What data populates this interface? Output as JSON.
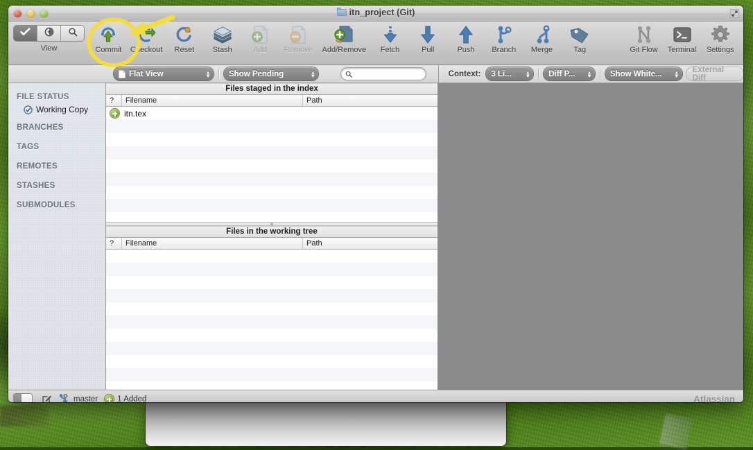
{
  "window": {
    "title": "itn_project (Git)",
    "title_icon": "folder-icon",
    "zoom_icon": "fullscreen-icon"
  },
  "toolbar": {
    "view_group_label": "View",
    "view_segments": [
      {
        "name": "checkmark-icon",
        "selected": true
      },
      {
        "name": "clock-history-icon",
        "selected": false
      },
      {
        "name": "search-icon",
        "selected": false
      }
    ],
    "items": [
      {
        "label": "Commit",
        "icon": "commit-up-arrow-icon",
        "enabled": true,
        "highlighted": true
      },
      {
        "label": "Checkout",
        "icon": "checkout-arrow-icon",
        "enabled": true,
        "highlighted": false
      },
      {
        "label": "Reset",
        "icon": "reset-circular-arrow-icon",
        "enabled": true,
        "highlighted": false
      },
      {
        "label": "Stash",
        "icon": "stash-box-icon",
        "enabled": true,
        "highlighted": false
      },
      {
        "label": "Add",
        "icon": "add-plus-file-icon",
        "enabled": false,
        "highlighted": false
      },
      {
        "label": "Remove",
        "icon": "remove-minus-file-icon",
        "enabled": false,
        "highlighted": false
      },
      {
        "label": "Add/Remove",
        "icon": "add-remove-file-icon",
        "enabled": true,
        "highlighted": false
      },
      {
        "label": "Fetch",
        "icon": "fetch-down-arrow-icon",
        "enabled": true,
        "highlighted": false
      },
      {
        "label": "Pull",
        "icon": "pull-down-arrow-icon",
        "enabled": true,
        "highlighted": false
      },
      {
        "label": "Push",
        "icon": "push-up-arrow-icon",
        "enabled": true,
        "highlighted": false
      },
      {
        "label": "Branch",
        "icon": "branch-graph-icon",
        "enabled": true,
        "highlighted": false
      },
      {
        "label": "Merge",
        "icon": "merge-graph-icon",
        "enabled": true,
        "highlighted": false
      },
      {
        "label": "Tag",
        "icon": "tag-label-icon",
        "enabled": true,
        "highlighted": false
      },
      {
        "label": "Git Flow",
        "icon": "git-flow-graph-icon",
        "enabled": true,
        "highlighted": false
      },
      {
        "label": "Terminal",
        "icon": "terminal-prompt-icon",
        "enabled": true,
        "highlighted": false
      },
      {
        "label": "Settings",
        "icon": "gear-icon",
        "enabled": true,
        "highlighted": false
      }
    ]
  },
  "subbar": {
    "view_mode": "Flat View",
    "view_mode_icon": "document-icon",
    "pending_filter": "Show Pending",
    "search_placeholder": "",
    "search_value": "",
    "search_icon": "search-icon",
    "context_label": "Context:",
    "context_value": "3 Li...",
    "diff_value": "Diff P...",
    "whitespace_value": "Show White...",
    "external_diff_label": "External Diff"
  },
  "sidebar": {
    "sections": [
      {
        "label": "FILE STATUS",
        "items": [
          {
            "label": "Working Copy",
            "icon": "check-circle-icon",
            "selected": true
          }
        ]
      },
      {
        "label": "BRANCHES",
        "items": []
      },
      {
        "label": "TAGS",
        "items": []
      },
      {
        "label": "REMOTES",
        "items": []
      },
      {
        "label": "STASHES",
        "items": []
      },
      {
        "label": "SUBMODULES",
        "items": []
      }
    ]
  },
  "staged_pane": {
    "title": "Files staged in the index",
    "columns": [
      "?",
      "Filename",
      "Path"
    ],
    "rows": [
      {
        "status_icon": "added-plus-icon",
        "filename": "itn.tex",
        "path": ""
      }
    ],
    "empty_row_count": 9
  },
  "worktree_pane": {
    "title": "Files in the working tree",
    "columns": [
      "?",
      "Filename",
      "Path"
    ],
    "rows": [],
    "empty_row_count": 11
  },
  "statusbar": {
    "sidebar_toggle_icon": "sidebar-toggle-icon",
    "edit_icon": "edit-pencil-icon",
    "branch_icon": "branch-pull-icon",
    "branch_name": "master",
    "added_icon": "added-plus-icon",
    "added_text": "1 Added",
    "brand": "Atlassian"
  },
  "annotation": {
    "highlight_target": "Commit",
    "shape": "circle-with-arrow",
    "color": "#f5dd3a"
  },
  "colors": {
    "accent_yellow": "#f5dd3a",
    "diff_pane_gray": "#8a8a8a",
    "row_alt": "#f4f6fa",
    "sidebar_heading": "#68727f"
  }
}
